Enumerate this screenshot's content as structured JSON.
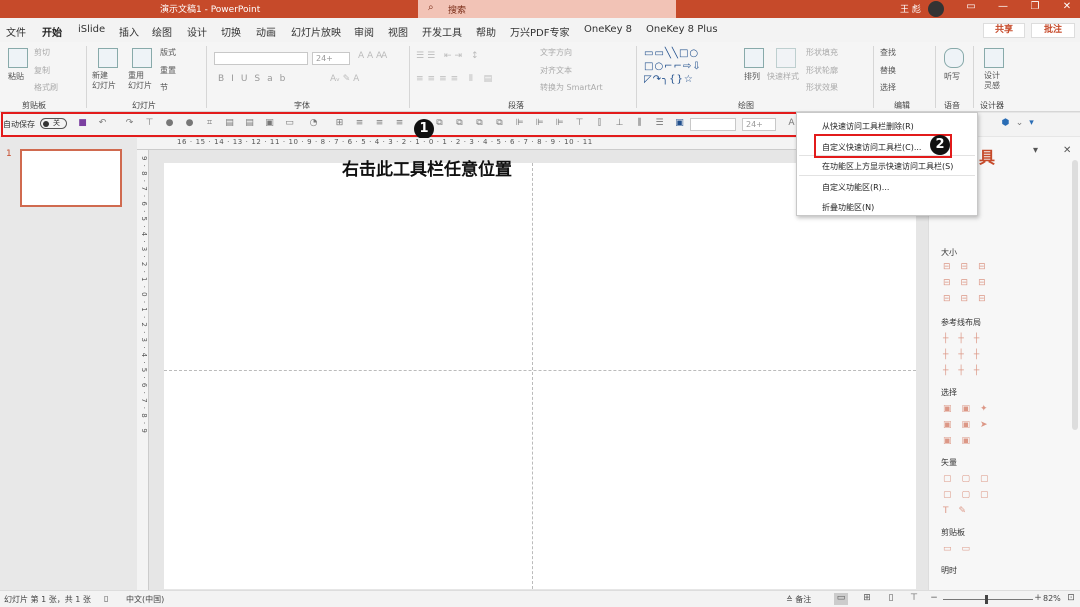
{
  "titlebar": {
    "doc_title": "演示文稿1 - PowerPoint",
    "search_placeholder": "搜索",
    "user": "王 彪"
  },
  "tabs": [
    "文件",
    "开始",
    "iSlide",
    "插入",
    "绘图",
    "设计",
    "切换",
    "动画",
    "幻灯片放映",
    "审阅",
    "视图",
    "开发工具",
    "帮助",
    "万兴PDF专家",
    "OneKey 8",
    "OneKey 8 Plus"
  ],
  "active_tab": "开始",
  "actions": {
    "share": "共享",
    "comments": "批注"
  },
  "ribbon": {
    "clipboard": {
      "label": "剪贴板",
      "paste": "粘贴",
      "cut": "剪切",
      "copy": "复制",
      "format_painter": "格式刷"
    },
    "slides": {
      "label": "幻灯片",
      "new_slide": "新建\n幻灯片",
      "reuse": "重用\n幻灯片",
      "layout": "版式",
      "reset": "重置",
      "section": "节"
    },
    "font": {
      "label": "字体",
      "font_name": "",
      "font_size": "24+"
    },
    "paragraph": {
      "label": "段落",
      "text_direction": "文字方向",
      "align_text": "对齐文本",
      "smartart": "转换为 SmartArt"
    },
    "drawing": {
      "label": "绘图",
      "arrange": "排列",
      "quick_styles": "快速样式",
      "shape_fill": "形状填充",
      "shape_outline": "形状轮廓",
      "shape_effects": "形状效果"
    },
    "editing": {
      "label": "编辑",
      "find": "查找",
      "replace": "替换",
      "select": "选择"
    },
    "voice": {
      "label": "语音",
      "dictate": "听写"
    },
    "designer": {
      "label": "设计器",
      "design_ideas": "设计\n灵感"
    }
  },
  "qat": {
    "autosave_label": "自动保存",
    "autosave_state": "关",
    "font_size": "24+"
  },
  "markers": {
    "one": "1",
    "two": "2"
  },
  "instruction": "右击此工具栏任意位置",
  "context_menu": {
    "items": [
      "从快速访问工具栏删除(R)",
      "自定义快速访问工具栏(C)...",
      "在功能区上方显示快速访问工具栏(S)",
      "自定义功能区(R)...",
      "折叠功能区(N)"
    ],
    "highlighted_index": 1
  },
  "thumbnail": {
    "slide_number": "1"
  },
  "rulers": {
    "horizontal": "16 · 15 · 14 · 13 · 12 · 11 · 10 · 9 · 8 · 7 · 6 · 5 · 4 · 3 · 2 · 1 · 0 · 1 · 2 · 3 · 4 · 5 · 6 · 7 · 8 · 9 · 10 · 11",
    "vertical": "9 · 8 · 7 · 6 · 5 · 4 · 3 · 2 · 1 · 0 · 1 · 2 · 3 · 4 · 5 · 6 · 7 · 8 · 9"
  },
  "right_panel": {
    "title": "具",
    "sections": [
      "大小",
      "参考线布局",
      "选择",
      "矢量",
      "剪贴板",
      "明时"
    ]
  },
  "statusbar": {
    "slide_info": "幻灯片 第 1 张，共 1 张",
    "language": "中文(中国)",
    "notes": "备注",
    "zoom": "82%"
  },
  "colors": {
    "accent": "#c64a2a",
    "highlight_box": "#e21b1b"
  }
}
